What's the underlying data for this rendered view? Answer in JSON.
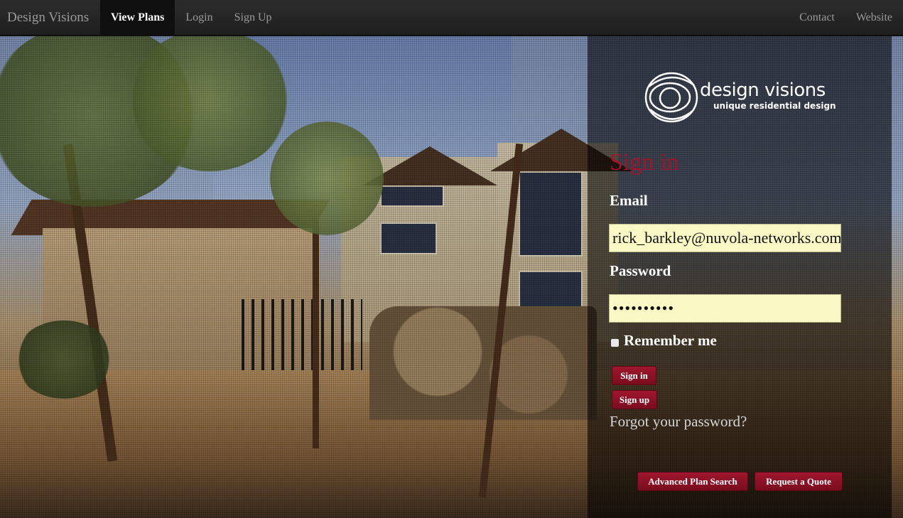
{
  "navbar": {
    "brand": "Design Visions",
    "left_items": [
      {
        "label": "View Plans",
        "active": true
      },
      {
        "label": "Login",
        "active": false
      },
      {
        "label": "Sign Up",
        "active": false
      }
    ],
    "right_items": [
      {
        "label": "Contact"
      },
      {
        "label": "Website"
      }
    ]
  },
  "logo": {
    "name": "design visions",
    "tagline": "unique residential design"
  },
  "signin": {
    "title": "Sign in",
    "email_label": "Email",
    "email_value": "rick_barkley@nuvola-networks.com",
    "password_label": "Password",
    "password_value": "••••••••••",
    "remember_label": "Remember me",
    "signin_button": "Sign in",
    "signup_button": "Sign up",
    "forgot_link": "Forgot your password?"
  },
  "footer_buttons": {
    "advanced_search": "Advanced Plan Search",
    "request_quote": "Request a Quote"
  },
  "colors": {
    "accent": "#a1132a",
    "input_bg": "#faf8c4",
    "navbar_bg": "#222222"
  }
}
